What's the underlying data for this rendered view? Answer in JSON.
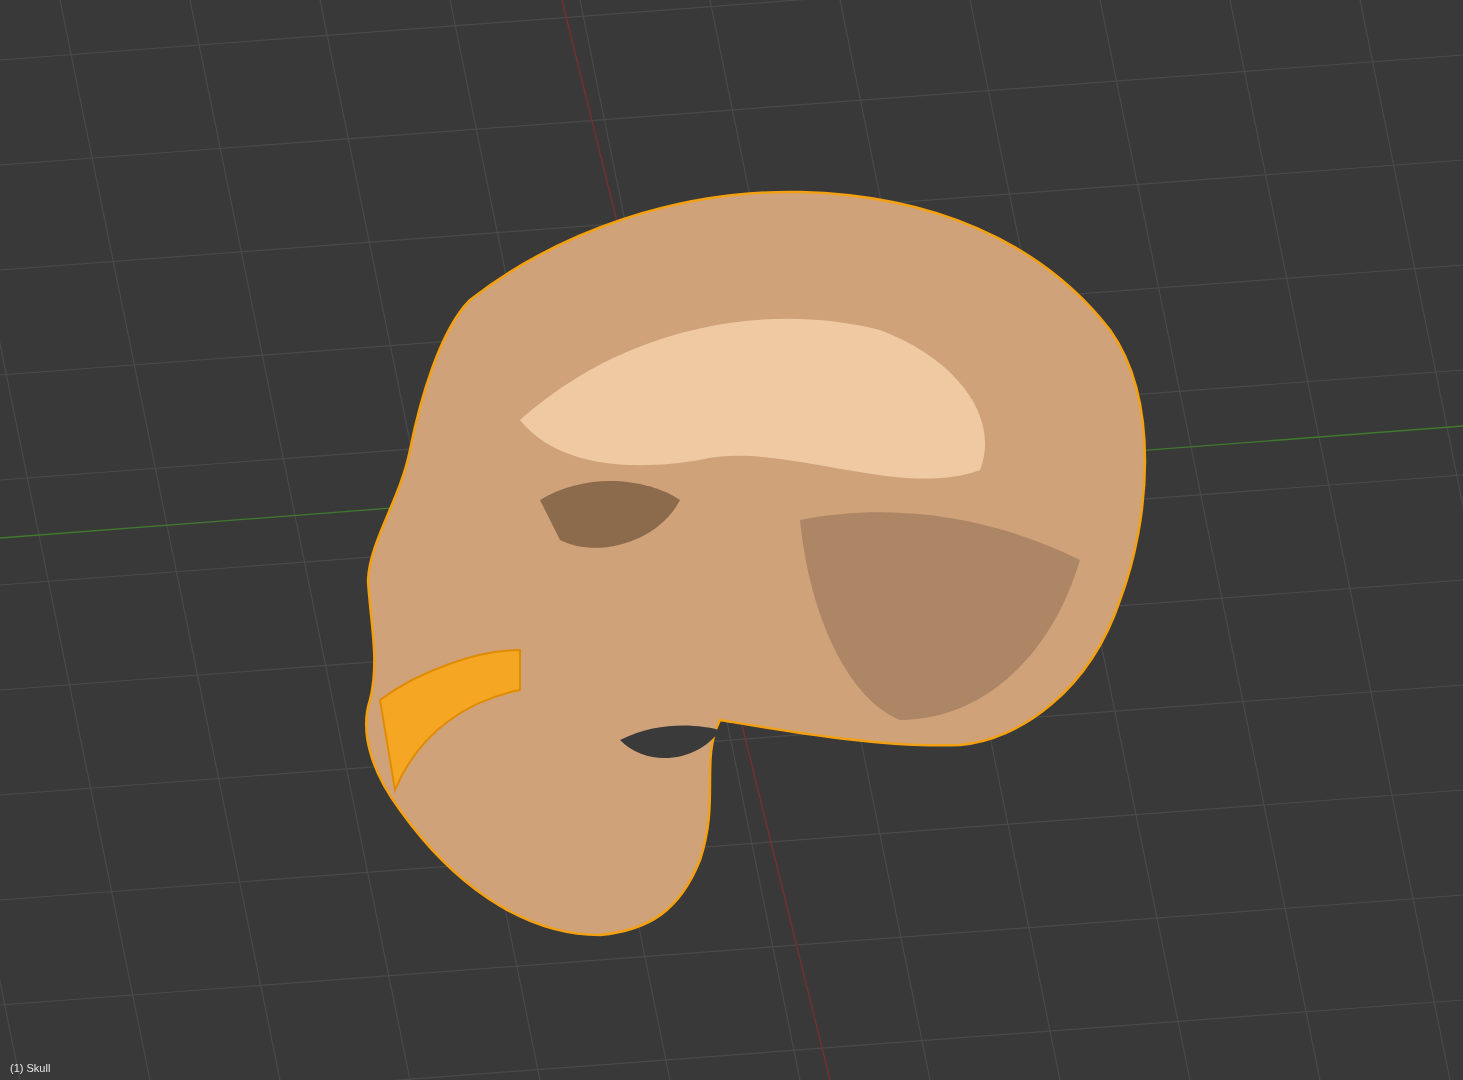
{
  "viewport": {
    "object_label": "(1) Skull"
  }
}
